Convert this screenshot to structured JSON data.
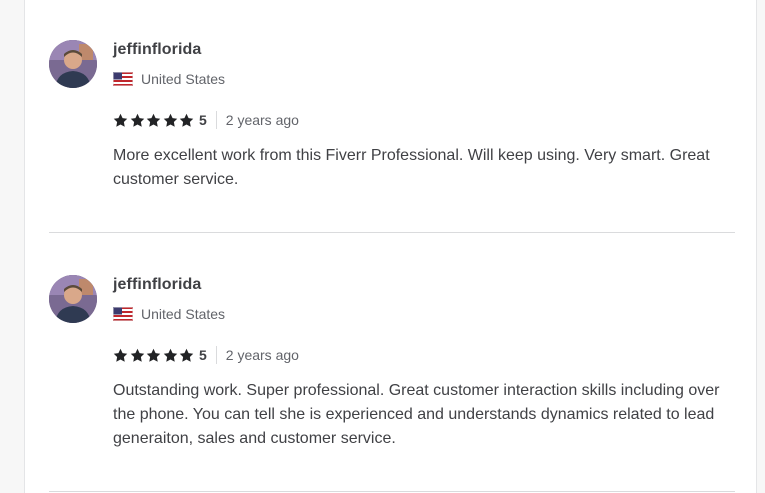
{
  "reviews": [
    {
      "username": "jeffinflorida",
      "country": "United States",
      "rating": "5",
      "rating_value": 5,
      "time_ago": "2 years ago",
      "text": "More excellent work from this Fiverr Professional. Will keep using. Very smart. Great customer service."
    },
    {
      "username": "jeffinflorida",
      "country": "United States",
      "rating": "5",
      "rating_value": 5,
      "time_ago": "2 years ago",
      "text": "Outstanding work. Super professional. Great customer interaction skills including over the phone. You can tell she is experienced and understands dynamics related to lead generaiton, sales and customer service."
    }
  ],
  "icons": {
    "star": "star-icon",
    "flag": "us-flag-icon",
    "avatar": "user-avatar"
  },
  "colors": {
    "text_primary": "#404145",
    "text_secondary": "#62646a",
    "star": "#222325",
    "divider": "#dadbdd"
  }
}
